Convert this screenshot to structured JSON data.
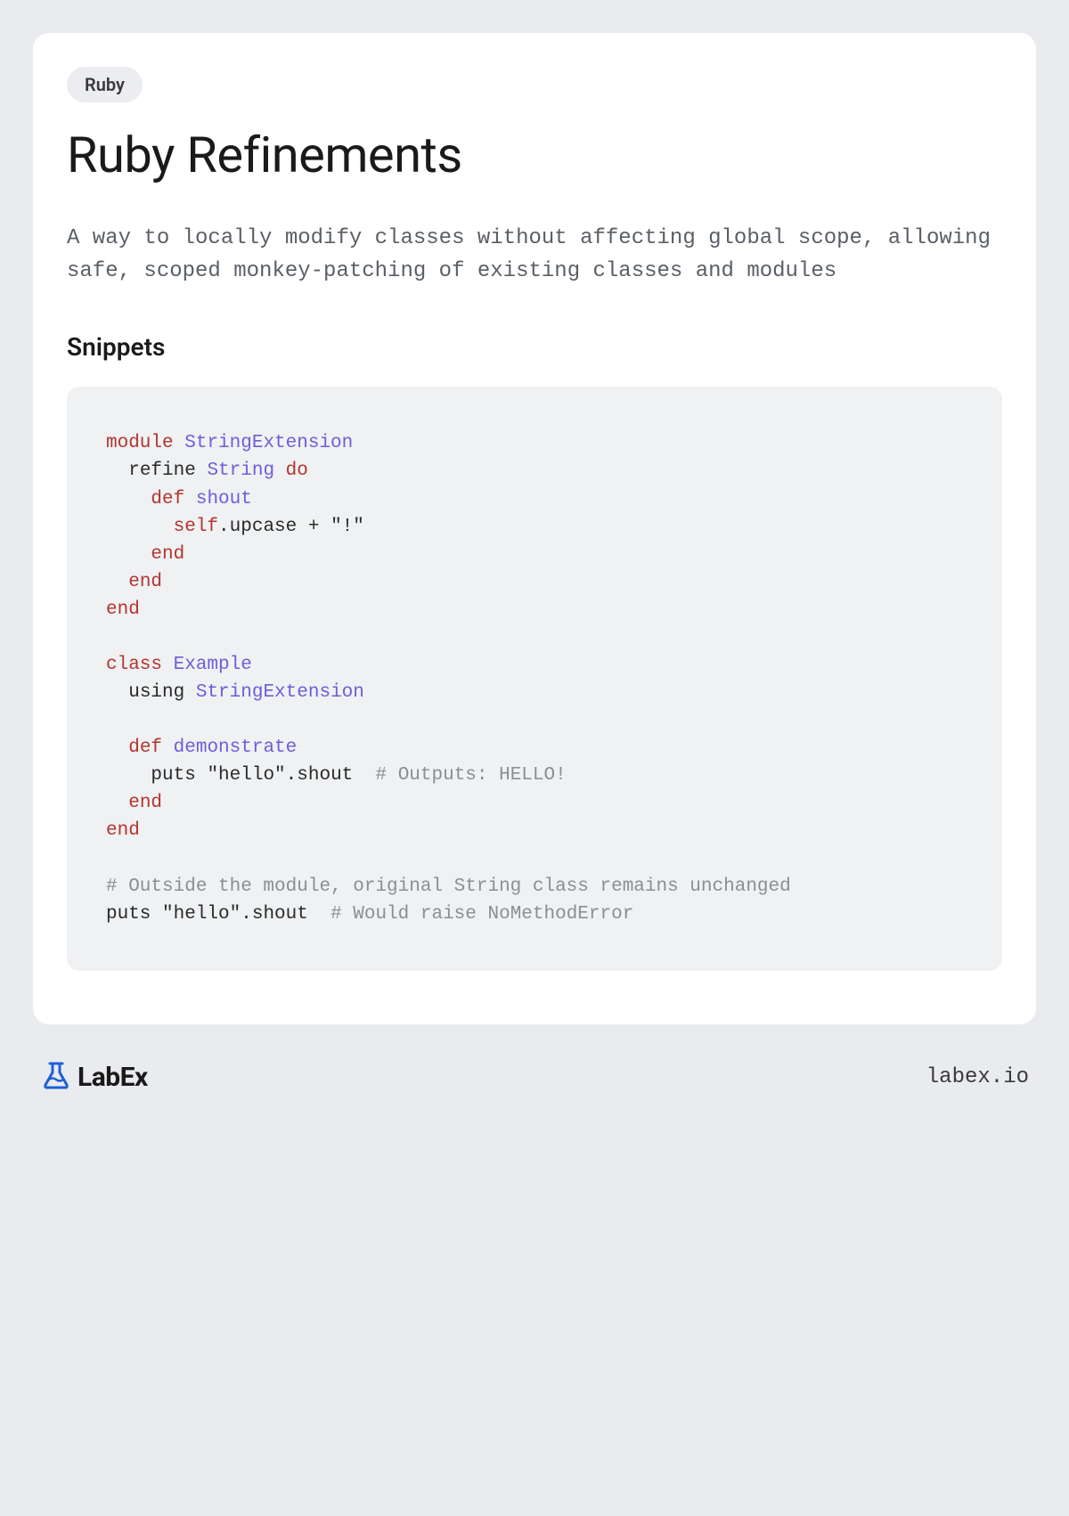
{
  "tag": "Ruby",
  "title": "Ruby Refinements",
  "description": "A way to locally modify classes without affecting global scope, allowing safe, scoped monkey-patching of existing classes and modules",
  "section_heading": "Snippets",
  "code": {
    "tokens": [
      {
        "t": "module",
        "c": "keyword"
      },
      {
        "t": " "
      },
      {
        "t": "StringExtension",
        "c": "class"
      },
      {
        "t": "\n"
      },
      {
        "t": "  refine "
      },
      {
        "t": "String",
        "c": "class"
      },
      {
        "t": " "
      },
      {
        "t": "do",
        "c": "keyword"
      },
      {
        "t": "\n"
      },
      {
        "t": "    "
      },
      {
        "t": "def",
        "c": "keyword"
      },
      {
        "t": " "
      },
      {
        "t": "shout",
        "c": "method"
      },
      {
        "t": "\n"
      },
      {
        "t": "      "
      },
      {
        "t": "self",
        "c": "self"
      },
      {
        "t": ".upcase + "
      },
      {
        "t": "\"!\"",
        "c": "string"
      },
      {
        "t": "\n"
      },
      {
        "t": "    "
      },
      {
        "t": "end",
        "c": "keyword"
      },
      {
        "t": "\n"
      },
      {
        "t": "  "
      },
      {
        "t": "end",
        "c": "keyword"
      },
      {
        "t": "\n"
      },
      {
        "t": "end",
        "c": "keyword"
      },
      {
        "t": "\n"
      },
      {
        "t": "\n"
      },
      {
        "t": "class",
        "c": "keyword"
      },
      {
        "t": " "
      },
      {
        "t": "Example",
        "c": "class"
      },
      {
        "t": "\n"
      },
      {
        "t": "  using "
      },
      {
        "t": "StringExtension",
        "c": "class"
      },
      {
        "t": "\n"
      },
      {
        "t": "\n"
      },
      {
        "t": "  "
      },
      {
        "t": "def",
        "c": "keyword"
      },
      {
        "t": " "
      },
      {
        "t": "demonstrate",
        "c": "method"
      },
      {
        "t": "\n"
      },
      {
        "t": "    puts "
      },
      {
        "t": "\"hello\"",
        "c": "string"
      },
      {
        "t": ".shout  "
      },
      {
        "t": "# Outputs: HELLO!",
        "c": "comment"
      },
      {
        "t": "\n"
      },
      {
        "t": "  "
      },
      {
        "t": "end",
        "c": "keyword"
      },
      {
        "t": "\n"
      },
      {
        "t": "end",
        "c": "keyword"
      },
      {
        "t": "\n"
      },
      {
        "t": "\n"
      },
      {
        "t": "# Outside the module, original String class remains unchanged",
        "c": "comment"
      },
      {
        "t": "\n"
      },
      {
        "t": "puts "
      },
      {
        "t": "\"hello\"",
        "c": "string"
      },
      {
        "t": ".shout  "
      },
      {
        "t": "# Would raise NoMethodError",
        "c": "comment"
      }
    ]
  },
  "footer": {
    "brand": "LabEx",
    "url": "labex.io"
  }
}
